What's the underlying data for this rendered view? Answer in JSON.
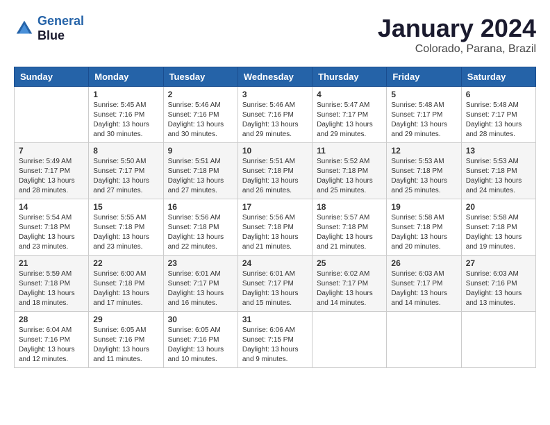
{
  "header": {
    "logo_line1": "General",
    "logo_line2": "Blue",
    "month": "January 2024",
    "location": "Colorado, Parana, Brazil"
  },
  "weekdays": [
    "Sunday",
    "Monday",
    "Tuesday",
    "Wednesday",
    "Thursday",
    "Friday",
    "Saturday"
  ],
  "weeks": [
    [
      {
        "day": "",
        "sunrise": "",
        "sunset": "",
        "daylight": ""
      },
      {
        "day": "1",
        "sunrise": "Sunrise: 5:45 AM",
        "sunset": "Sunset: 7:16 PM",
        "daylight": "Daylight: 13 hours and 30 minutes."
      },
      {
        "day": "2",
        "sunrise": "Sunrise: 5:46 AM",
        "sunset": "Sunset: 7:16 PM",
        "daylight": "Daylight: 13 hours and 30 minutes."
      },
      {
        "day": "3",
        "sunrise": "Sunrise: 5:46 AM",
        "sunset": "Sunset: 7:16 PM",
        "daylight": "Daylight: 13 hours and 29 minutes."
      },
      {
        "day": "4",
        "sunrise": "Sunrise: 5:47 AM",
        "sunset": "Sunset: 7:17 PM",
        "daylight": "Daylight: 13 hours and 29 minutes."
      },
      {
        "day": "5",
        "sunrise": "Sunrise: 5:48 AM",
        "sunset": "Sunset: 7:17 PM",
        "daylight": "Daylight: 13 hours and 29 minutes."
      },
      {
        "day": "6",
        "sunrise": "Sunrise: 5:48 AM",
        "sunset": "Sunset: 7:17 PM",
        "daylight": "Daylight: 13 hours and 28 minutes."
      }
    ],
    [
      {
        "day": "7",
        "sunrise": "Sunrise: 5:49 AM",
        "sunset": "Sunset: 7:17 PM",
        "daylight": "Daylight: 13 hours and 28 minutes."
      },
      {
        "day": "8",
        "sunrise": "Sunrise: 5:50 AM",
        "sunset": "Sunset: 7:17 PM",
        "daylight": "Daylight: 13 hours and 27 minutes."
      },
      {
        "day": "9",
        "sunrise": "Sunrise: 5:51 AM",
        "sunset": "Sunset: 7:18 PM",
        "daylight": "Daylight: 13 hours and 27 minutes."
      },
      {
        "day": "10",
        "sunrise": "Sunrise: 5:51 AM",
        "sunset": "Sunset: 7:18 PM",
        "daylight": "Daylight: 13 hours and 26 minutes."
      },
      {
        "day": "11",
        "sunrise": "Sunrise: 5:52 AM",
        "sunset": "Sunset: 7:18 PM",
        "daylight": "Daylight: 13 hours and 25 minutes."
      },
      {
        "day": "12",
        "sunrise": "Sunrise: 5:53 AM",
        "sunset": "Sunset: 7:18 PM",
        "daylight": "Daylight: 13 hours and 25 minutes."
      },
      {
        "day": "13",
        "sunrise": "Sunrise: 5:53 AM",
        "sunset": "Sunset: 7:18 PM",
        "daylight": "Daylight: 13 hours and 24 minutes."
      }
    ],
    [
      {
        "day": "14",
        "sunrise": "Sunrise: 5:54 AM",
        "sunset": "Sunset: 7:18 PM",
        "daylight": "Daylight: 13 hours and 23 minutes."
      },
      {
        "day": "15",
        "sunrise": "Sunrise: 5:55 AM",
        "sunset": "Sunset: 7:18 PM",
        "daylight": "Daylight: 13 hours and 23 minutes."
      },
      {
        "day": "16",
        "sunrise": "Sunrise: 5:56 AM",
        "sunset": "Sunset: 7:18 PM",
        "daylight": "Daylight: 13 hours and 22 minutes."
      },
      {
        "day": "17",
        "sunrise": "Sunrise: 5:56 AM",
        "sunset": "Sunset: 7:18 PM",
        "daylight": "Daylight: 13 hours and 21 minutes."
      },
      {
        "day": "18",
        "sunrise": "Sunrise: 5:57 AM",
        "sunset": "Sunset: 7:18 PM",
        "daylight": "Daylight: 13 hours and 21 minutes."
      },
      {
        "day": "19",
        "sunrise": "Sunrise: 5:58 AM",
        "sunset": "Sunset: 7:18 PM",
        "daylight": "Daylight: 13 hours and 20 minutes."
      },
      {
        "day": "20",
        "sunrise": "Sunrise: 5:58 AM",
        "sunset": "Sunset: 7:18 PM",
        "daylight": "Daylight: 13 hours and 19 minutes."
      }
    ],
    [
      {
        "day": "21",
        "sunrise": "Sunrise: 5:59 AM",
        "sunset": "Sunset: 7:18 PM",
        "daylight": "Daylight: 13 hours and 18 minutes."
      },
      {
        "day": "22",
        "sunrise": "Sunrise: 6:00 AM",
        "sunset": "Sunset: 7:18 PM",
        "daylight": "Daylight: 13 hours and 17 minutes."
      },
      {
        "day": "23",
        "sunrise": "Sunrise: 6:01 AM",
        "sunset": "Sunset: 7:17 PM",
        "daylight": "Daylight: 13 hours and 16 minutes."
      },
      {
        "day": "24",
        "sunrise": "Sunrise: 6:01 AM",
        "sunset": "Sunset: 7:17 PM",
        "daylight": "Daylight: 13 hours and 15 minutes."
      },
      {
        "day": "25",
        "sunrise": "Sunrise: 6:02 AM",
        "sunset": "Sunset: 7:17 PM",
        "daylight": "Daylight: 13 hours and 14 minutes."
      },
      {
        "day": "26",
        "sunrise": "Sunrise: 6:03 AM",
        "sunset": "Sunset: 7:17 PM",
        "daylight": "Daylight: 13 hours and 14 minutes."
      },
      {
        "day": "27",
        "sunrise": "Sunrise: 6:03 AM",
        "sunset": "Sunset: 7:16 PM",
        "daylight": "Daylight: 13 hours and 13 minutes."
      }
    ],
    [
      {
        "day": "28",
        "sunrise": "Sunrise: 6:04 AM",
        "sunset": "Sunset: 7:16 PM",
        "daylight": "Daylight: 13 hours and 12 minutes."
      },
      {
        "day": "29",
        "sunrise": "Sunrise: 6:05 AM",
        "sunset": "Sunset: 7:16 PM",
        "daylight": "Daylight: 13 hours and 11 minutes."
      },
      {
        "day": "30",
        "sunrise": "Sunrise: 6:05 AM",
        "sunset": "Sunset: 7:16 PM",
        "daylight": "Daylight: 13 hours and 10 minutes."
      },
      {
        "day": "31",
        "sunrise": "Sunrise: 6:06 AM",
        "sunset": "Sunset: 7:15 PM",
        "daylight": "Daylight: 13 hours and 9 minutes."
      },
      {
        "day": "",
        "sunrise": "",
        "sunset": "",
        "daylight": ""
      },
      {
        "day": "",
        "sunrise": "",
        "sunset": "",
        "daylight": ""
      },
      {
        "day": "",
        "sunrise": "",
        "sunset": "",
        "daylight": ""
      }
    ]
  ]
}
